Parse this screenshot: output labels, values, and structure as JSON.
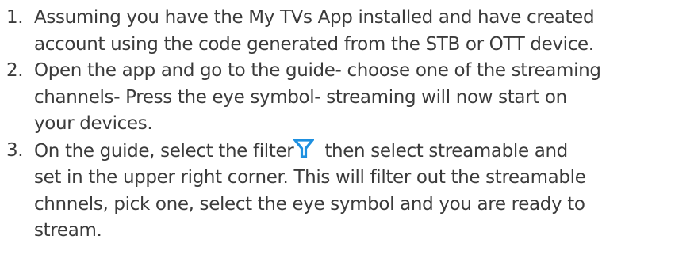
{
  "steps": [
    {
      "number": "1.",
      "lines": [
        "Assuming you have the My TVs App installed and have created",
        "account using the code generated from the STB or OTT device."
      ]
    },
    {
      "number": "2.",
      "lines": [
        "Open the app and go to the guide- choose one of the streaming",
        "channels- Press the eye symbol- streaming will now start on",
        "your devices."
      ]
    },
    {
      "number": "3.",
      "line_before_icon": "On the guide, select the filter",
      "icon": "filter-icon",
      "icon_color": "#1e90e0",
      "line_after_icon": "then select streamable and",
      "lines": [
        "set in the upper right corner. This will filter out the streamable",
        "chnnels, pick one, select the eye symbol and you are ready to",
        "stream."
      ]
    }
  ]
}
